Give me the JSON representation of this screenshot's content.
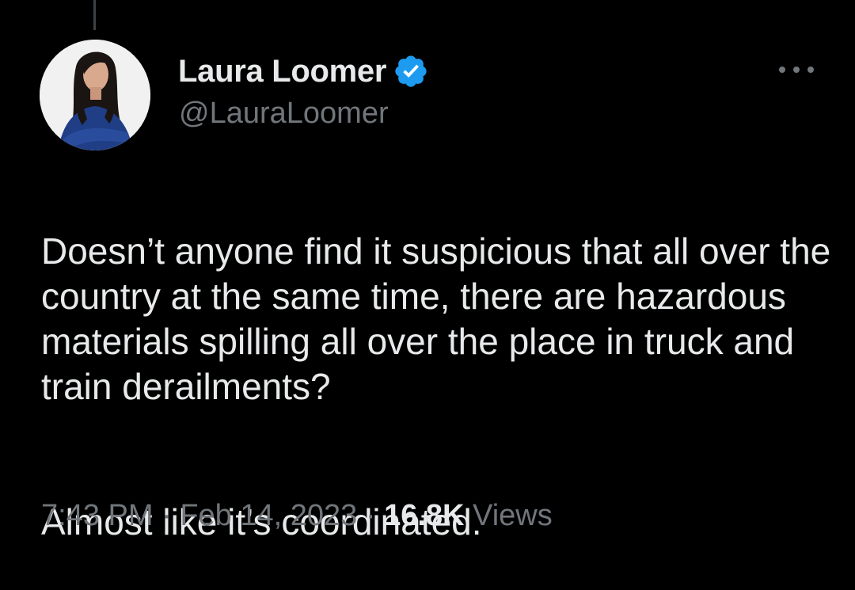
{
  "tweet": {
    "author": {
      "display_name": "Laura Loomer",
      "handle": "@LauraLoomer",
      "verified": true,
      "verified_badge_color": "#1d9bf0",
      "avatar_icon": "profile-photo"
    },
    "text_paragraphs": [
      "Doesn’t anyone find it suspicious that all over the country at the same time, there are hazardous materials spilling all over the place in truck and train derailments?",
      "Almost like it’s coordinated."
    ],
    "meta": {
      "time": "7:43 PM",
      "separator": "·",
      "date": "Feb 14, 2023",
      "views_count": "16.8K",
      "views_label": "Views"
    },
    "more_icon": "more-horizontal-icon"
  },
  "colors": {
    "background": "#000000",
    "primary_text": "#e7e9ea",
    "secondary_text": "#71767b"
  }
}
